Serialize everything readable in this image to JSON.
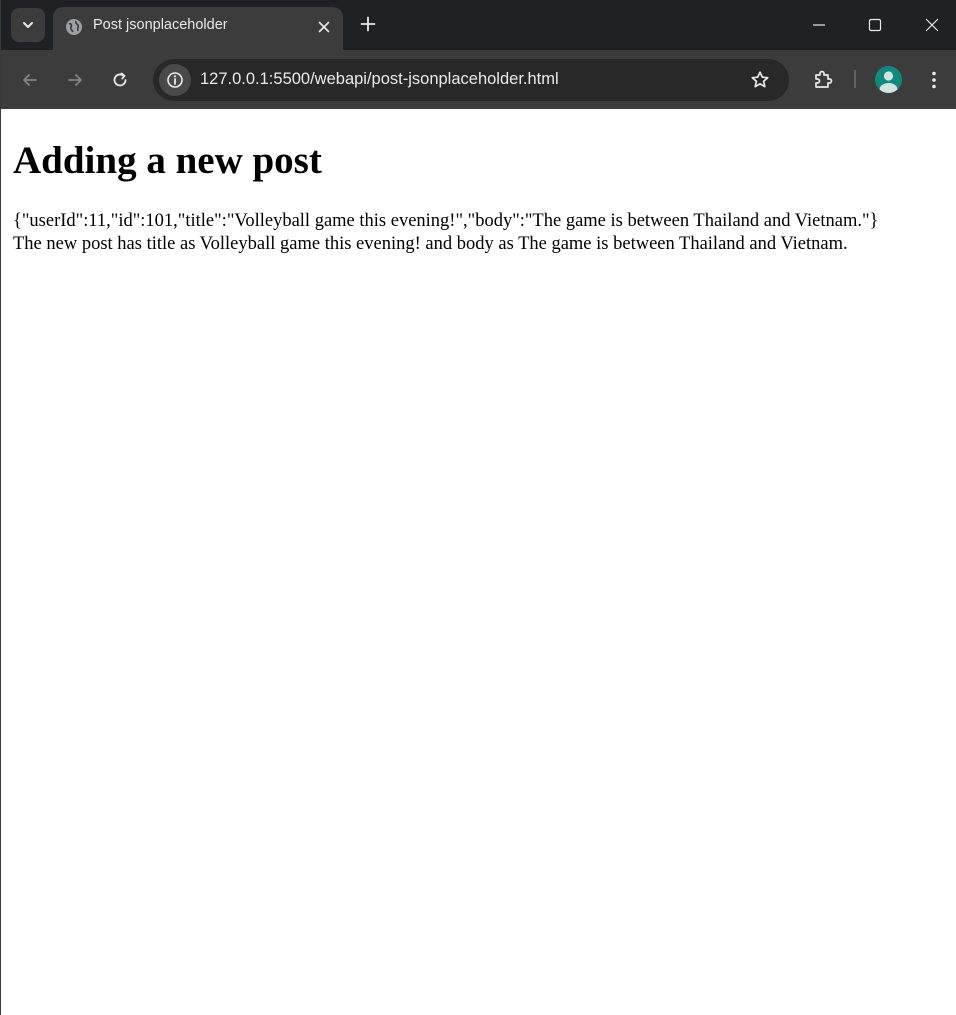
{
  "browser": {
    "tab": {
      "title": "Post jsonplaceholder",
      "favicon": "globe-icon"
    },
    "address_bar": {
      "url": "127.0.0.1:5500/webapi/post-jsonplaceholder.html"
    },
    "colors": {
      "frame": "#202124",
      "toolbar": "#3c3c3c",
      "omnibox": "#282828",
      "profile_avatar": "#0f8a7e"
    }
  },
  "page": {
    "heading": "Adding a new post",
    "response_json": "{\"userId\":11,\"id\":101,\"title\":\"Volleyball game this evening!\",\"body\":\"The game is between Thailand and Vietnam.\"}",
    "summary": "The new post has title as Volleyball game this evening! and body as The game is between Thailand and Vietnam."
  }
}
